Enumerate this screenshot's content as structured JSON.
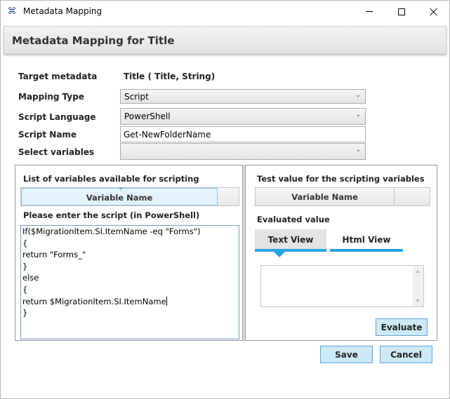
{
  "window": {
    "title": "Metadata Mapping",
    "icon": "share-nodes-icon"
  },
  "header": {
    "title": "Metadata Mapping for Title"
  },
  "form": {
    "target_metadata_label": "Target metadata",
    "target_metadata_value": "Title ( Title, String)",
    "mapping_type_label": "Mapping Type",
    "mapping_type_value": "Script",
    "script_language_label": "Script Language",
    "script_language_value": "PowerShell",
    "script_name_label": "Script Name",
    "script_name_value": "Get-NewFolderName",
    "select_variables_label": "Select variables",
    "select_variables_value": ""
  },
  "left_panel": {
    "variables_title": "List of variables available for scripting",
    "variables_column": "Variable Name",
    "script_prompt": "Please enter the script (in PowerShell)",
    "script_lines": [
      "If($MigrationItem.SI.ItemName -eq \"Forms\")",
      "{",
      "return \"Forms_\"",
      "}",
      "else",
      "{",
      "return $MigrationItem.SI.ItemName",
      "}"
    ]
  },
  "right_panel": {
    "test_title": "Test value for the scripting variables",
    "variables_column": "Variable Name",
    "evaluated_label": "Evaluated value",
    "tabs": [
      {
        "label": "Text View",
        "active": true
      },
      {
        "label": "Html View",
        "active": false
      }
    ],
    "evaluate_button": "Evaluate"
  },
  "footer": {
    "save_label": "Save",
    "cancel_label": "Cancel"
  },
  "colors": {
    "accent": "#29a3e0",
    "button_bg": "#cde8f6",
    "button_border": "#5aa7d7"
  }
}
